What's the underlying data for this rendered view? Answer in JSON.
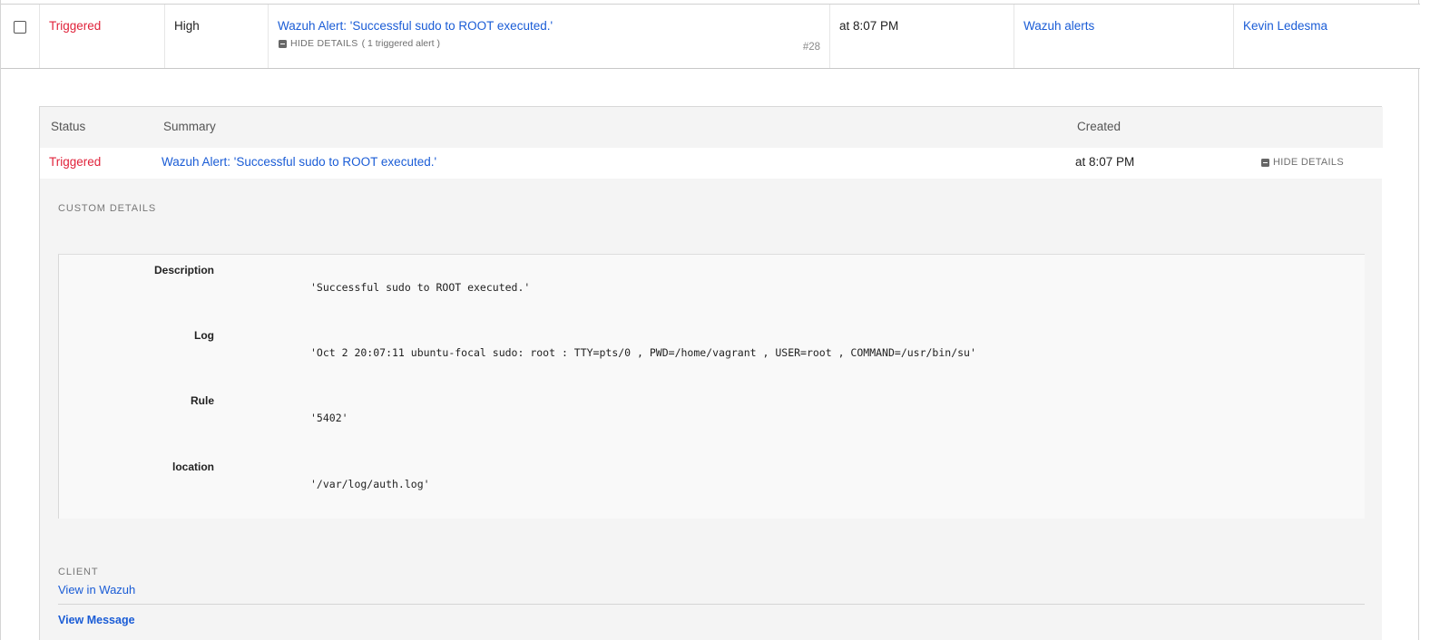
{
  "incident": {
    "status": "Triggered",
    "urgency": "High",
    "title": "Wazuh Alert: 'Successful sudo to ROOT executed.'",
    "hide_details_label": "HIDE DETAILS",
    "triggered_count": "( 1 triggered alert )",
    "number": "#28",
    "created": "at 8:07 PM",
    "service": "Wazuh alerts",
    "assignee": "Kevin Ledesma"
  },
  "alerts_table": {
    "headers": {
      "status": "Status",
      "summary": "Summary",
      "created": "Created"
    },
    "row": {
      "status": "Triggered",
      "summary": "Wazuh Alert: 'Successful sudo to ROOT executed.'",
      "created": "at 8:07 PM",
      "hide_details_label": "HIDE DETAILS"
    }
  },
  "custom_details": {
    "label": "CUSTOM DETAILS",
    "fields": [
      {
        "key": "Description",
        "value": "'Successful sudo to ROOT executed.'"
      },
      {
        "key": "Log",
        "value": "'Oct 2 20:07:11 ubuntu-focal sudo: root : TTY=pts/0 , PWD=/home/vagrant , USER=root , COMMAND=/usr/bin/su'"
      },
      {
        "key": "Rule",
        "value": "'5402'"
      },
      {
        "key": "location",
        "value": "'/var/log/auth.log'"
      }
    ]
  },
  "client": {
    "label": "CLIENT",
    "link": "View in Wazuh"
  },
  "view_message": "View Message",
  "colors": {
    "triggered": "#e0233b",
    "link": "#1a5cd6",
    "panel_bg": "#f4f4f4"
  },
  "icons": {
    "checkbox": "checkbox-icon",
    "collapse": "minus-square-icon"
  }
}
